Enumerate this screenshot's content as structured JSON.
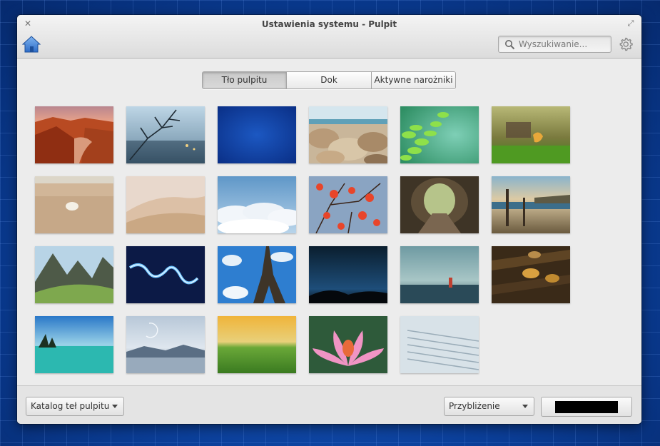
{
  "window": {
    "title": "Ustawienia systemu - Pulpit"
  },
  "search": {
    "placeholder": "Wyszukiwanie..."
  },
  "tabs": [
    {
      "label": "Tło pulpitu",
      "active": true
    },
    {
      "label": "Dok",
      "active": false
    },
    {
      "label": "Aktywne narożniki",
      "active": false
    }
  ],
  "wallpapers": [
    "canyon",
    "frosted-branches",
    "blue-gradient",
    "seaside-rocks",
    "green-fern",
    "autumn-bench",
    "beach-shell",
    "sand-dunes",
    "clouds",
    "red-leaves",
    "wooden-tunnel",
    "coast-fence",
    "mountain-valley",
    "blue-light-swirl",
    "eiffel-tower",
    "night-sky",
    "lighthouse-sea",
    "fallen-leaves",
    "lake-island",
    "misty-lake-moon",
    "wheat-field-sunset",
    "pink-lotus",
    "blurred-blinds"
  ],
  "footer": {
    "catalog_label": "Katalog teł pulpitu",
    "scaling_label": "Przybliżenie",
    "color_value": "#000000"
  },
  "colors": {
    "accent": "#3d7fd6",
    "desktop_background": "#0b3f9a"
  },
  "icons": {
    "close": "close-icon",
    "maximize": "maximize-icon",
    "home": "home-icon",
    "search": "search-icon",
    "settings": "gear-icon"
  }
}
